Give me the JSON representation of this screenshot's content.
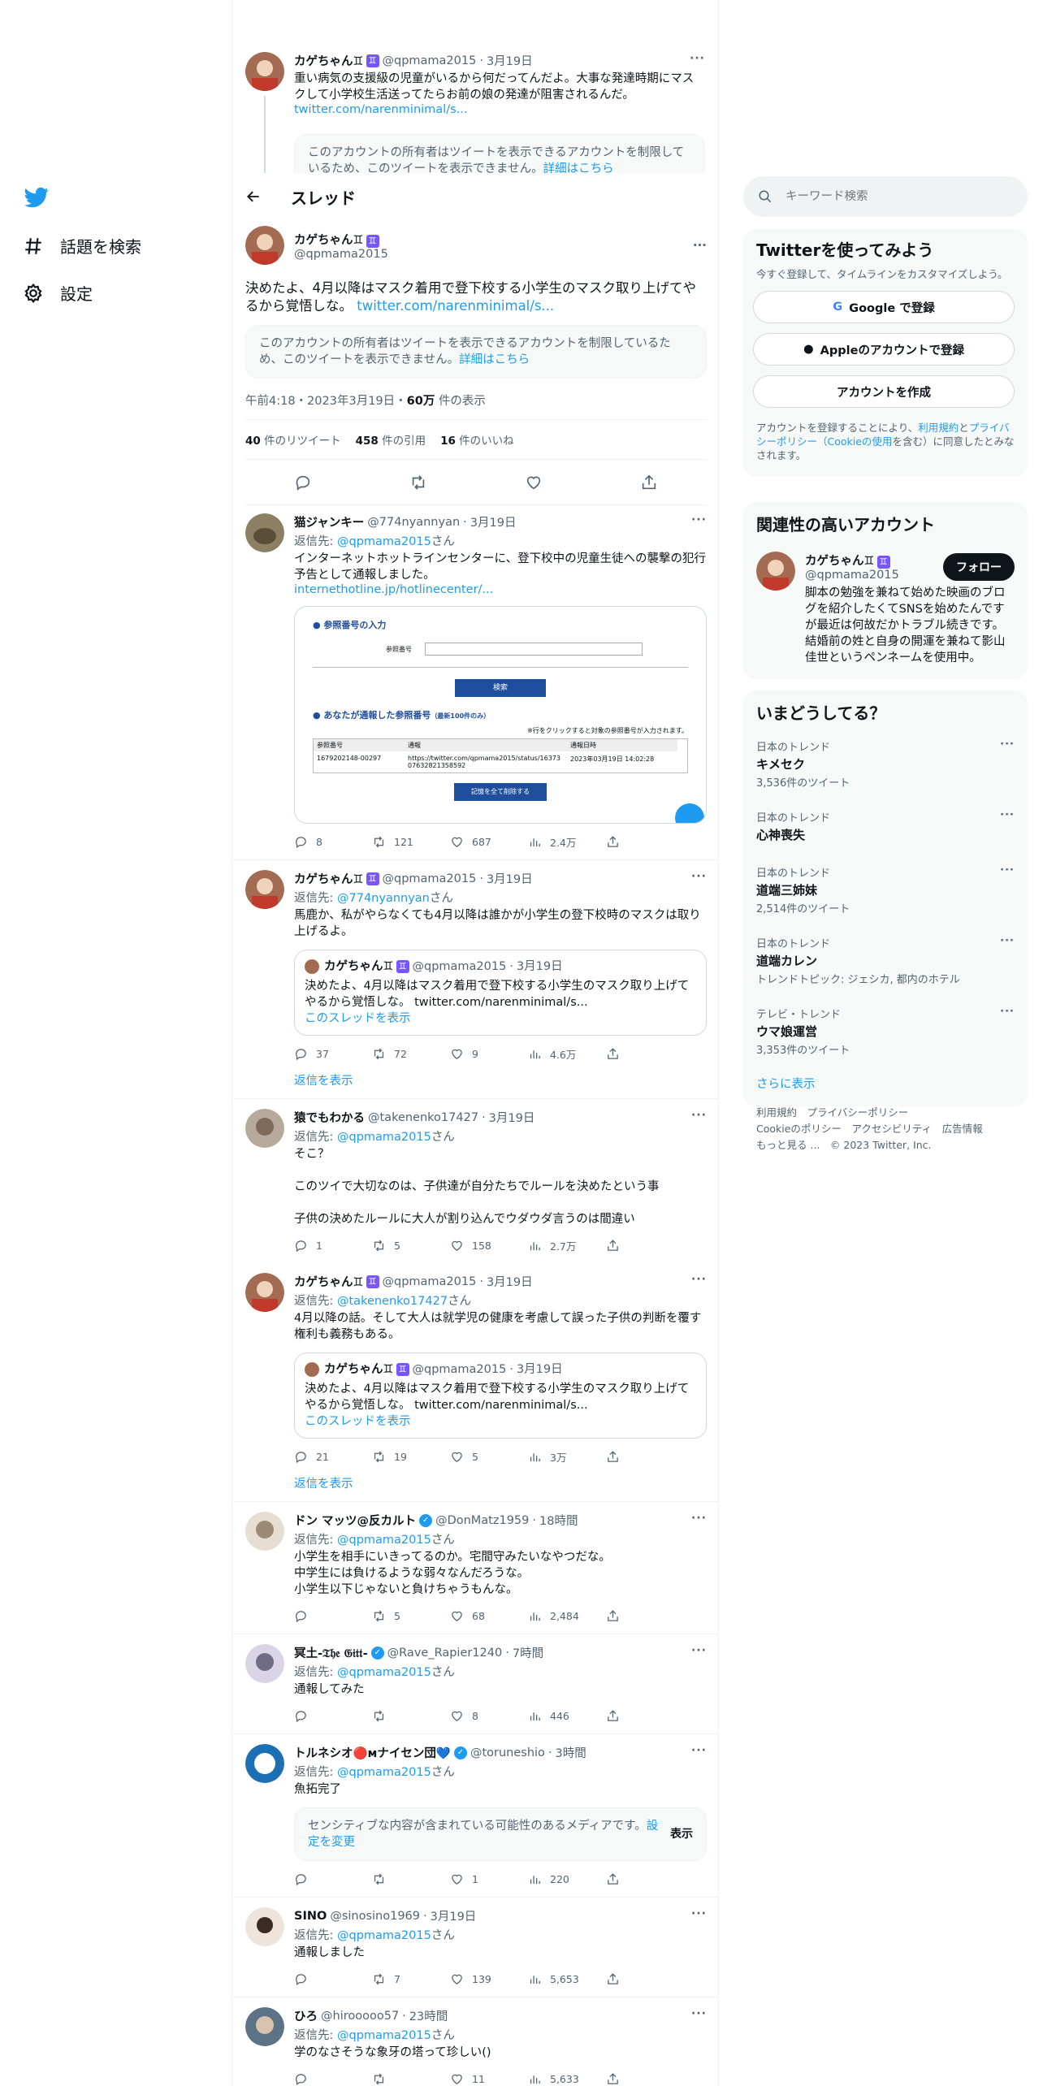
{
  "nav": {
    "explore": "話題を検索",
    "settings": "設定"
  },
  "search": {
    "placeholder": "キーワード検索"
  },
  "header": {
    "title": "スレッド"
  },
  "prev_tweet": {
    "name": "カゲちゃん♊︎",
    "handle": "@qpmama2015",
    "date": "3月19日",
    "text": "重い病気の支援級の児童がいるから何だってんだよ。大事な発達時期にマスクして小学校生活送ってたらお前の娘の発達が阻害されるんだ。",
    "link": "twitter.com/narenminimal/s...",
    "lock_text": "このアカウントの所有者はツイートを表示できるアカウントを制限しているため、このツイートを表示できません。",
    "lock_link": "詳細はこちら"
  },
  "main_tweet": {
    "name": "カゲちゃん♊︎",
    "handle": "@qpmama2015",
    "text": "決めたよ、4月以降はマスク着用で登下校する小学生のマスク取り上げてやるから覚悟しな。",
    "link": "twitter.com/narenminimal/s...",
    "lock_text": "このアカウントの所有者はツイートを表示できるアカウントを制限しているため、このツイートを表示できません。",
    "lock_link": "詳細はこちら",
    "time": "午前4:18・2023年3月19日・",
    "views": "60万",
    "views_label": "件の表示",
    "retweets": "40",
    "retweets_label": "件のリツイート",
    "quotes": "458",
    "quotes_label": "件の引用",
    "likes": "16",
    "likes_label": "件のいいね"
  },
  "reply_prefix": "返信先: ",
  "reply_suffix": "さん",
  "show_thread": "このスレッドを表示",
  "show_replies": "返信を表示",
  "replies": [
    {
      "name": "猫ジャンキー",
      "handle": "@774nyannyan",
      "time": "3月19日",
      "reply_to": "@qpmama2015",
      "text": "インターネットホットラインセンターに、登下校中の児童生徒への襲撃の犯行予告として通報しました。",
      "link": "internethotline.jp/hotlinecenter/...",
      "reply": "8",
      "rt": "121",
      "like": "687",
      "views": "2.4万"
    },
    {
      "name": "カゲちゃん♊︎",
      "handle": "@qpmama2015",
      "time": "3月19日",
      "reply_to": "@774nyannyan",
      "text": "馬鹿か、私がやらなくても4月以降は誰かが小学生の登下校時のマスクは取り上げるよ。",
      "q_name": "カゲちゃん♊︎",
      "q_handle": "@qpmama2015",
      "q_time": "3月19日",
      "q_text": "決めたよ、4月以降はマスク着用で登下校する小学生のマスク取り上げてやるから覚悟しな。",
      "q_link": "twitter.com/narenminimal/s...",
      "reply": "37",
      "rt": "72",
      "like": "9",
      "views": "4.6万"
    },
    {
      "name": "猿でもわかる",
      "handle": "@takenenko17427",
      "time": "3月19日",
      "reply_to": "@qpmama2015",
      "text": "そこ？\n\nこのツイで大切なのは、子供達が自分たちでルールを決めたという事\n\n子供の決めたルールに大人が割り込んでウダウダ言うのは間違い",
      "reply": "1",
      "rt": "5",
      "like": "158",
      "views": "2.7万"
    },
    {
      "name": "カゲちゃん♊︎",
      "handle": "@qpmama2015",
      "time": "3月19日",
      "reply_to": "@takenenko17427",
      "text": "4月以降の話。そして大人は就学児の健康を考慮して誤った子供の判断を覆す権利も義務もある。",
      "q_name": "カゲちゃん♊︎",
      "q_handle": "@qpmama2015",
      "q_time": "3月19日",
      "q_text": "決めたよ、4月以降はマスク着用で登下校する小学生のマスク取り上げてやるから覚悟しな。",
      "q_link": "twitter.com/narenminimal/s...",
      "reply": "21",
      "rt": "19",
      "like": "5",
      "views": "3万"
    },
    {
      "name": "ドン マッツ@反カルト",
      "handle": "@DonMatz1959",
      "time": "18時間",
      "reply_to": "@qpmama2015",
      "text": "小学生を相手にいきってるのか。宅間守みたいなやつだな。\n中学生には負けるような弱々なんだろうな。\n小学生以下じゃないと負けちゃうもんな。",
      "reply": "",
      "rt": "5",
      "like": "68",
      "views": "2,484"
    },
    {
      "name": "冥土-𝔗𝔥𝔢 𝔊𝔦𝔱𝔱-",
      "handle": "@Rave_Rapier1240",
      "time": "7時間",
      "reply_to": "@qpmama2015",
      "text": "通報してみた",
      "reply": "",
      "rt": "",
      "like": "8",
      "views": "446"
    },
    {
      "name": "トルネシオ🔴ᴍナイセン団💙",
      "handle": "@toruneshio",
      "time": "3時間",
      "reply_to": "@qpmama2015",
      "text": "魚拓完了",
      "sensitive": "センシティブな内容が含まれている可能性のあるメディアです。",
      "sensitive_link": "設定を変更",
      "sensitive_btn": "表示",
      "reply": "",
      "rt": "",
      "like": "1",
      "views": "220"
    },
    {
      "name": "SINO",
      "handle": "@sinosino1969",
      "time": "3月19日",
      "reply_to": "@qpmama2015",
      "text": "通報しました",
      "reply": "",
      "rt": "7",
      "like": "139",
      "views": "5,653"
    },
    {
      "name": "ひろ",
      "handle": "@hirooooo57",
      "time": "23時間",
      "reply_to": "@qpmama2015",
      "text": "学のなさそうな象牙の塔って珍しい()",
      "reply": "",
      "rt": "",
      "like": "11",
      "views": "5,633"
    }
  ],
  "screenshot_card": {
    "section1": "● 参照番号の入力",
    "field_label": "参照番号",
    "search_btn": "検索",
    "section2": "● あなたが通報した参照番号",
    "section2_sub": "（最新100件のみ）",
    "hint": "※行をクリックすると対象の参照番号が入力されます。",
    "col1": "参照番号",
    "col2": "通報",
    "col3": "通報日時",
    "row_id": "1679202148-00297",
    "row_url": "https://twitter.com/qpmama2015/status/1637307632821358592",
    "row_date": "2023年03月19日 14:02:28",
    "clear_btn": "記憶を全て削除する"
  },
  "signup": {
    "title": "Twitterを使ってみよう",
    "desc": "今すぐ登録して、タイムラインをカスタマイズしよう。",
    "google": "Google で登録",
    "apple": "Appleのアカウントで登録",
    "create": "アカウントを作成",
    "legal_pre": "アカウントを登録することにより、",
    "legal_link1": "利用規約",
    "legal_and": "と",
    "legal_link2": "プライバシーポリシー（Cookieの使用",
    "legal_post": "を含む）に同意したとみなされます。"
  },
  "related": {
    "title": "関連性の高いアカウント",
    "name": "カゲちゃん♊︎",
    "handle": "@qpmama2015",
    "follow": "フォロー",
    "bio": "脚本の勉強を兼ねて始めた映画のブログを紹介したくてSNSを始めたんですが最近は何故だかトラブル続きです。結婚前の姓と自身の開運を兼ねて影山佳世というペンネームを使用中。"
  },
  "trends": {
    "title": "いまどうしてる？",
    "items": [
      {
        "context": "日本のトレンド",
        "name": "キメセク",
        "count": "3,536件のツイート"
      },
      {
        "context": "日本のトレンド",
        "name": "心神喪失",
        "count": ""
      },
      {
        "context": "日本のトレンド",
        "name": "道端三姉妹",
        "count": "2,514件のツイート"
      },
      {
        "context": "日本のトレンド",
        "name": "道端カレン",
        "count": "トレンドトピック: ジェシカ, 都内のホテル"
      },
      {
        "context": "テレビ・トレンド",
        "name": "ウマ娘運営",
        "count": "3,353件のツイート"
      }
    ],
    "more": "さらに表示"
  },
  "footer": {
    "l1": "利用規約",
    "l2": "プライバシーポリシー",
    "l3": "Cookieのポリシー",
    "l4": "アクセシビリティ",
    "l5": "広告情報",
    "l6": "もっと見る ...",
    "copy": "© 2023 Twitter, Inc."
  },
  "colors": {
    "accent": "#1d9bf0",
    "text": "#0f1419",
    "muted": "#536471"
  }
}
